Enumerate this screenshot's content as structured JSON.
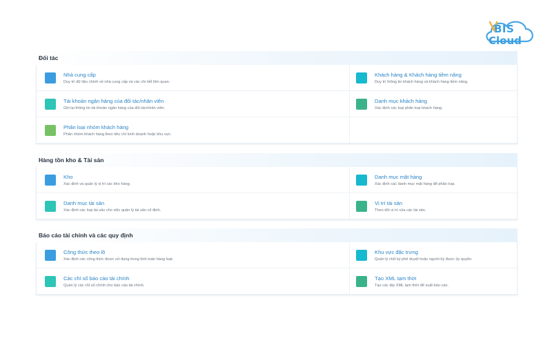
{
  "logo": {
    "line1": "BIS",
    "line2": "Cloud"
  },
  "sections": [
    {
      "title": "Đối tác",
      "items": [
        {
          "title": "Nhà cung cấp",
          "desc": "Duy trì dữ liệu chính về nhà cung cấp và các chi tiết liên quan.",
          "icon": "blue-square-icon",
          "color": "#3b9de0"
        },
        {
          "title": "Khách hàng & Khách hàng tiềm năng",
          "desc": "Duy trì thông tin khách hàng và khách hàng tiềm năng.",
          "icon": "cyan-square-icon",
          "color": "#17b9cf"
        },
        {
          "title": "Tài khoản ngân hàng của đối tác/nhân viên",
          "desc": "Ghi lại thông tin tài khoản ngân hàng của đối tác/nhân viên.",
          "icon": "teal-square-icon",
          "color": "#2ec4b6"
        },
        {
          "title": "Danh mục khách hàng",
          "desc": "Xác định các loại phân loại khách hàng.",
          "icon": "green-square-icon",
          "color": "#3bb38a"
        },
        {
          "title": "Phân loại nhóm khách hàng",
          "desc": "Phân nhóm khách hàng theo tiêu chí kinh doanh hoặc khu vực.",
          "icon": "lime-square-icon",
          "color": "#77c265"
        }
      ]
    },
    {
      "title": "Hàng tồn kho & Tài sản",
      "items": [
        {
          "title": "Kho",
          "desc": "Xác định và quản lý vị trí các kho hàng.",
          "icon": "blue-square-icon",
          "color": "#3b9de0"
        },
        {
          "title": "Danh mục mặt hàng",
          "desc": "Xác định các danh mục mặt hàng để phân loại.",
          "icon": "cyan-square-icon",
          "color": "#17b9cf"
        },
        {
          "title": "Danh mục tài sản",
          "desc": "Xác định các loại tài sản cho việc quản lý tài sản cố định.",
          "icon": "teal-square-icon",
          "color": "#2ec4b6"
        },
        {
          "title": "Vị trí tài sản",
          "desc": "Theo dõi vị trí của các tài sản.",
          "icon": "green-square-icon",
          "color": "#3bb38a"
        }
      ]
    },
    {
      "title": "Báo cáo tài chính và các quy định",
      "items": [
        {
          "title": "Công thức theo lô",
          "desc": "Xác định các công thức được sử dụng trong tính toán hàng loạt.",
          "icon": "blue-square-icon",
          "color": "#3b9de0"
        },
        {
          "title": "Khu vực đặc trưng",
          "desc": "Quản lý chữ ký phê duyệt hoặc người ký được ủy quyền.",
          "icon": "cyan-square-icon",
          "color": "#17b9cf"
        },
        {
          "title": "Các chỉ số báo cáo tài chính",
          "desc": "Quản lý các chỉ số chính cho báo cáo tài chính.",
          "icon": "teal-square-icon",
          "color": "#2ec4b6"
        },
        {
          "title": "Tạo XML tạm thời",
          "desc": "Tạo các tệp XML tạm thời để xuất báo cáo.",
          "icon": "green-square-icon",
          "color": "#3bb38a"
        }
      ]
    }
  ]
}
